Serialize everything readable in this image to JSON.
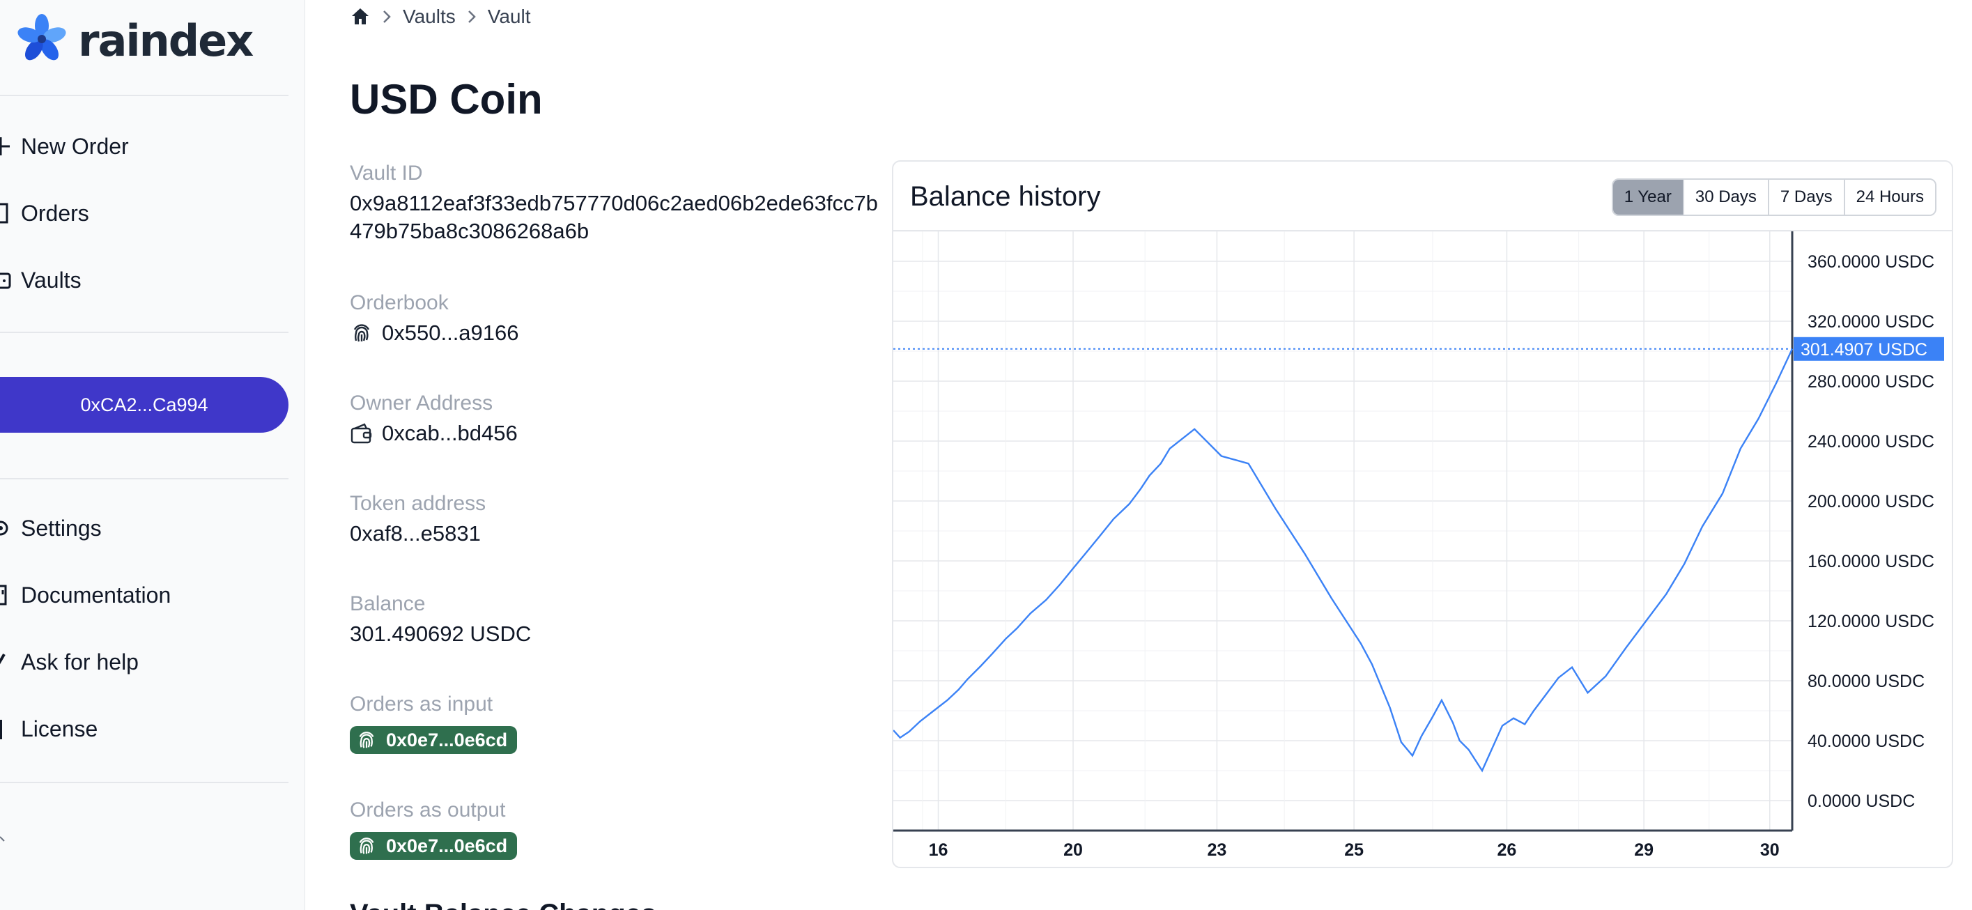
{
  "sidebar": {
    "logo_text": "raindex",
    "nav_top": [
      {
        "label": "New Order",
        "icon": "plus-icon"
      },
      {
        "label": "Orders",
        "icon": "receipt-icon"
      },
      {
        "label": "Vaults",
        "icon": "wallet-icon"
      }
    ],
    "wallet_address": "0xCA2...Ca994",
    "nav_bottom": [
      {
        "label": "Settings",
        "icon": "gear-icon"
      },
      {
        "label": "Documentation",
        "icon": "book-icon"
      },
      {
        "label": "Ask for help",
        "icon": "help-icon"
      },
      {
        "label": "License",
        "icon": "document-icon"
      }
    ]
  },
  "breadcrumb": {
    "home_icon": "home-icon",
    "items": [
      "Vaults",
      "Vault"
    ]
  },
  "page_title": "USD Coin",
  "fields": {
    "vault_id_label": "Vault ID",
    "vault_id_value": "0x9a8112eaf3f33edb757770d06c2aed06b2ede63fcc7b479b75ba8c3086268a6b",
    "orderbook_label": "Orderbook",
    "orderbook_value": "0x550...a9166",
    "owner_label": "Owner Address",
    "owner_value": "0xcab...bd456",
    "token_label": "Token address",
    "token_value": "0xaf8...e5831",
    "balance_label": "Balance",
    "balance_value": "301.490692 USDC",
    "orders_input_label": "Orders as input",
    "orders_input_value": "0x0e7...0e6cd",
    "orders_output_label": "Orders as output",
    "orders_output_value": "0x0e7...0e6cd"
  },
  "chart": {
    "title": "Balance history",
    "ranges": [
      "1 Year",
      "30 Days",
      "7 Days",
      "24 Hours"
    ],
    "active_range": "1 Year",
    "line_color": "#3b82f6",
    "badge_color": "#3b82f6"
  },
  "chart_data": {
    "type": "line",
    "title": "Balance history",
    "x_tick_labels": [
      "16",
      "20",
      "23",
      "25",
      "26",
      "29",
      "30"
    ],
    "y_tick_labels": [
      "0.0000 USDC",
      "40.0000 USDC",
      "80.0000 USDC",
      "120.0000 USDC",
      "160.0000 USDC",
      "200.0000 USDC",
      "240.0000 USDC",
      "280.0000 USDC",
      "320.0000 USDC",
      "360.0000 USDC"
    ],
    "ylim": [
      -20,
      380
    ],
    "y_ticks": [
      0,
      40,
      80,
      120,
      160,
      200,
      240,
      280,
      320,
      360
    ],
    "current_value": 301.4907,
    "current_label": "301.4907 USDC",
    "grid": true,
    "series": [
      {
        "x": [
          0,
          0.3,
          0.7,
          1.2,
          1.8,
          2.4,
          2.9,
          3.3,
          3.9,
          4.4,
          5.0,
          5.5,
          6.1,
          6.8,
          7.4,
          8.0,
          8.5,
          9.1,
          9.8,
          10.5,
          11.0,
          11.4,
          11.9,
          12.3,
          13.4,
          14.6,
          15.8,
          17.0,
          18.3,
          19.5,
          20.8,
          21.3,
          22.1,
          22.6,
          23.1,
          23.5,
          24.0,
          24.4,
          24.6,
          24.9,
          25.2,
          25.6,
          26.2,
          27.1,
          27.6,
          28.1,
          28.5,
          29.0,
          29.6,
          30.2,
          30.9,
          31.7,
          32.6,
          33.5,
          34.4,
          35.2,
          36.0,
          36.9,
          37.7,
          38.5,
          39.3,
          40.0
        ],
        "y": [
          47,
          42,
          46,
          53,
          60,
          67,
          74,
          81,
          90,
          98,
          108,
          115,
          125,
          134,
          144,
          155,
          164,
          175,
          188,
          198,
          208,
          217,
          225,
          235,
          248,
          230,
          225,
          195,
          165,
          135,
          105,
          91,
          62,
          39,
          30,
          43,
          56,
          67,
          61,
          52,
          40,
          34,
          20,
          50,
          55,
          51,
          60,
          70,
          82,
          89,
          72,
          83,
          102,
          120,
          138,
          158,
          183,
          205,
          235,
          255,
          279,
          301.49
        ]
      }
    ]
  },
  "section_heading": "Vault Balance Changes"
}
